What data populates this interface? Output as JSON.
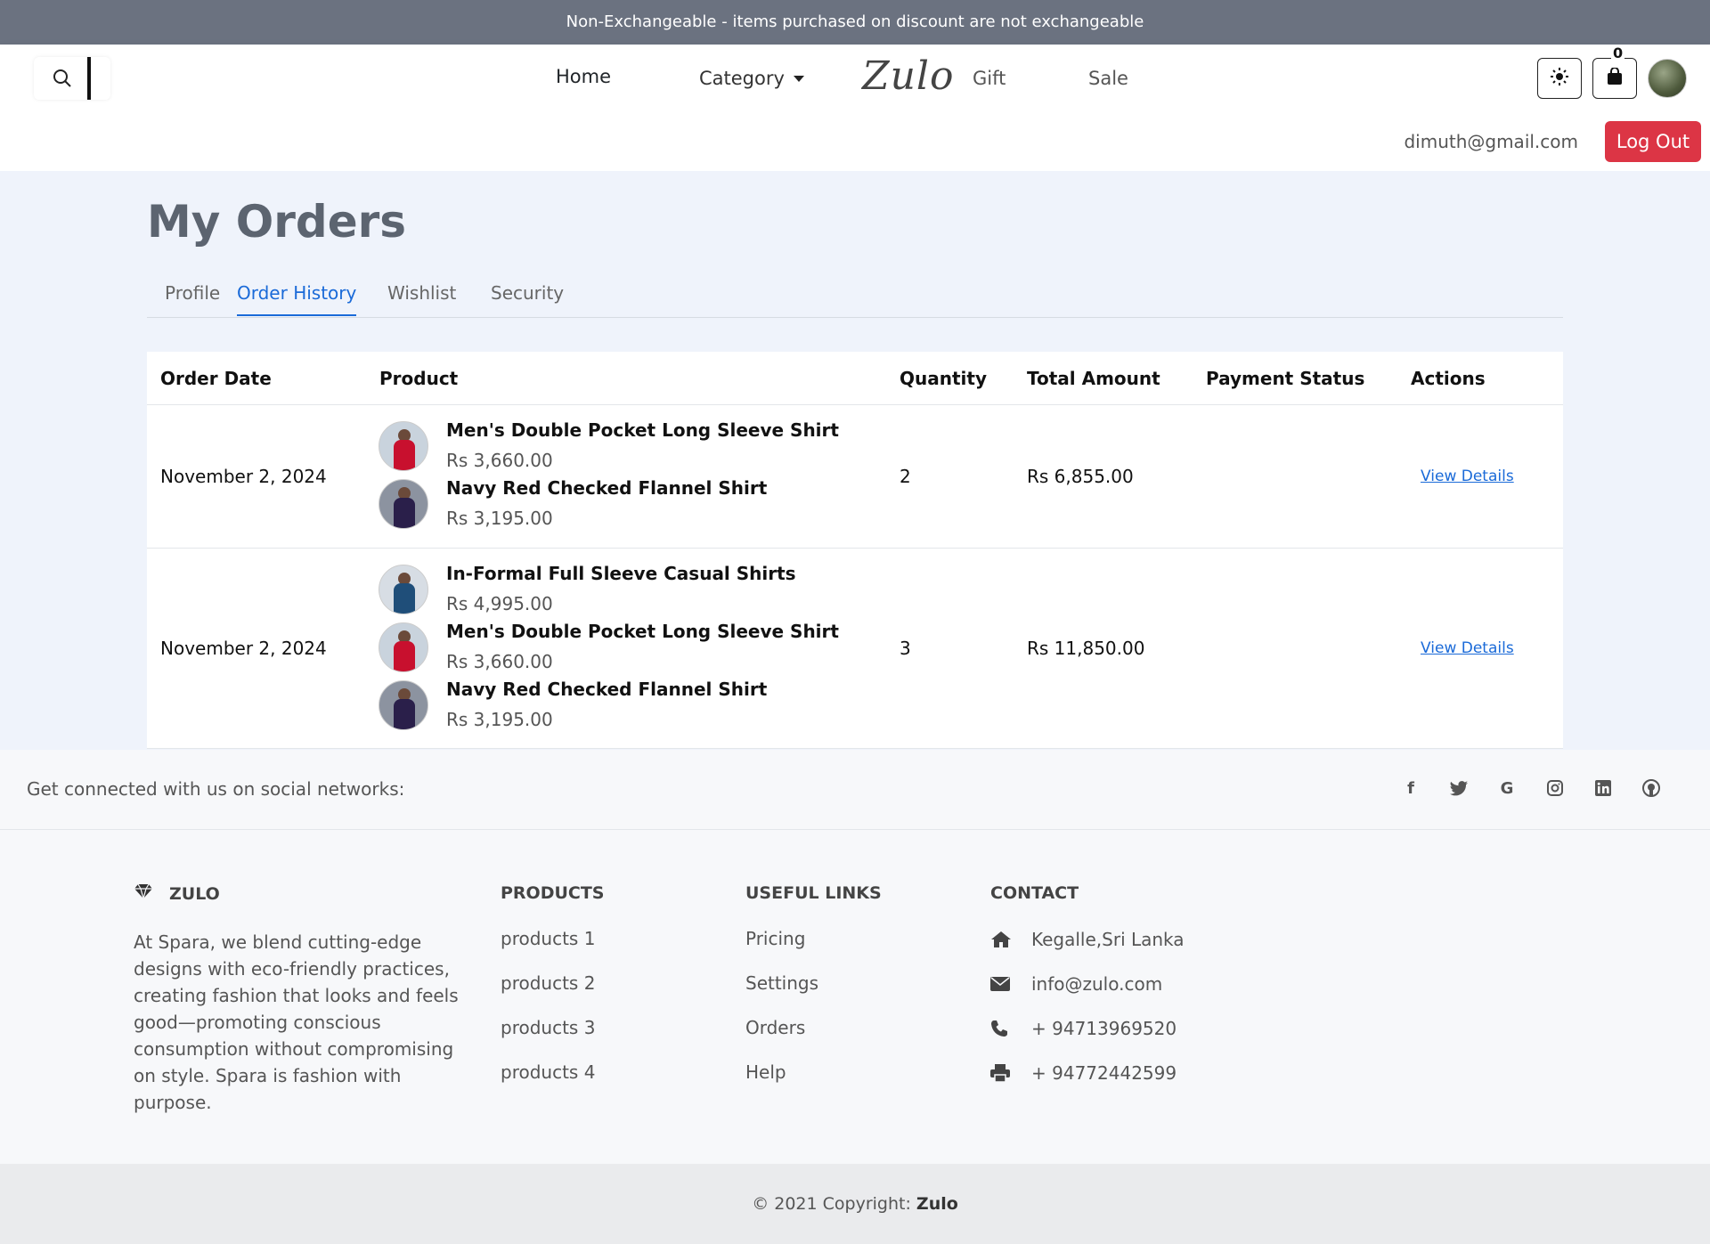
{
  "announcement": "Non-Exchangeable - items purchased on discount are not exchangeable",
  "nav": {
    "home": "Home",
    "category": "Category",
    "logo": "Zulo",
    "gift": "Gift",
    "sale": "Sale",
    "cart_count": "0"
  },
  "user": {
    "email": "dimuth@gmail.com",
    "logout": "Log Out"
  },
  "page": {
    "title": "My Orders",
    "tabs": [
      "Profile",
      "Order History",
      "Wishlist",
      "Security"
    ],
    "active_tab": "Order History"
  },
  "table": {
    "headers": [
      "Order Date",
      "Product",
      "Quantity",
      "Total Amount",
      "Payment Status",
      "Actions"
    ],
    "orders": [
      {
        "date": "November 2, 2024",
        "items": [
          {
            "name": "Men's Double Pocket Long Sleeve Shirt",
            "price": "Rs 3,660.00"
          },
          {
            "name": "Navy Red Checked Flannel Shirt",
            "price": "Rs 3,195.00"
          }
        ],
        "quantity": "2",
        "total": "Rs 6,855.00",
        "payment_status": "",
        "action": "View Details"
      },
      {
        "date": "November 2, 2024",
        "items": [
          {
            "name": "In-Formal Full Sleeve Casual Shirts",
            "price": "Rs 4,995.00"
          },
          {
            "name": "Men's Double Pocket Long Sleeve Shirt",
            "price": "Rs 3,660.00"
          },
          {
            "name": "Navy Red Checked Flannel Shirt",
            "price": "Rs 3,195.00"
          }
        ],
        "quantity": "3",
        "total": "Rs 11,850.00",
        "payment_status": "",
        "action": "View Details"
      }
    ]
  },
  "footer": {
    "social_text": "Get connected with us on social networks:",
    "social_icons": [
      "facebook-icon",
      "twitter-icon",
      "google-icon",
      "instagram-icon",
      "linkedin-icon",
      "github-icon"
    ],
    "brand": "ZULO",
    "about": "At Spara, we blend cutting-edge designs with eco-friendly practices, creating fashion that looks and feels good—promoting conscious consumption without compromising on style. Spara is fashion with purpose.",
    "products_heading": "PRODUCTS",
    "products": [
      "products 1",
      "products 2",
      "products 3",
      "products 4"
    ],
    "links_heading": "USEFUL LINKS",
    "links": [
      "Pricing",
      "Settings",
      "Orders",
      "Help"
    ],
    "contact_heading": "CONTACT",
    "contact": {
      "address": "Kegalle,Sri Lanka",
      "email": "info@zulo.com",
      "phone": "+ 94713969520",
      "fax": "+ 94772442599"
    },
    "copyright_prefix": "© 2021 Copyright: ",
    "copyright_brand": "Zulo"
  },
  "colors": {
    "announcement_bg": "#6b7280",
    "accent": "#1a6ad8",
    "logout": "#dc3545",
    "main_bg": "#eff3fb"
  }
}
